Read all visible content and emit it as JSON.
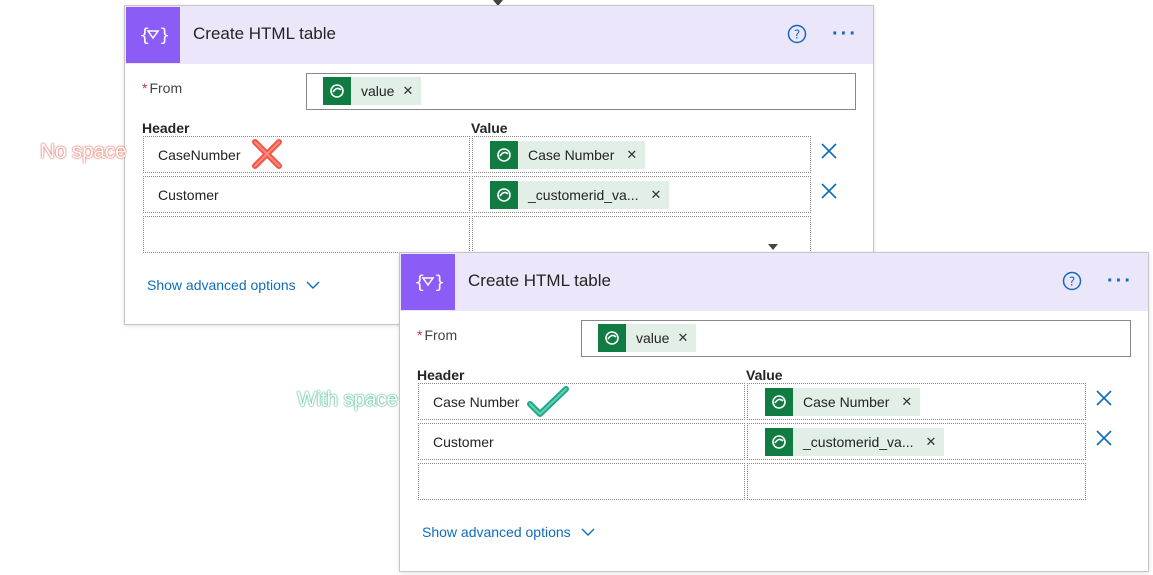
{
  "card1": {
    "title": "Create HTML table",
    "from_label": "From",
    "from_token": "value",
    "col_header": "Header",
    "col_value": "Value",
    "rows": [
      {
        "header": "CaseNumber",
        "value": "Case Number"
      },
      {
        "header": "Customer",
        "value": "_customerid_va..."
      }
    ],
    "advanced": "Show advanced options"
  },
  "card2": {
    "title": "Create HTML table",
    "from_label": "From",
    "from_token": "value",
    "col_header": "Header",
    "col_value": "Value",
    "rows": [
      {
        "header": "Case Number",
        "value": "Case Number"
      },
      {
        "header": "Customer",
        "value": "_customerid_va..."
      }
    ],
    "advanced": "Show advanced options"
  },
  "annotations": {
    "no_space": "No space",
    "with_space": "With space"
  },
  "icons": {
    "action_icon": "variable-braces-icon",
    "token_icon": "dataverse-icon",
    "help": "help-circle-icon",
    "more": "ellipsis-icon",
    "remove": "close-icon",
    "chevron": "chevron-down-icon",
    "wrong": "red-cross-icon",
    "right": "green-check-icon"
  },
  "colors": {
    "accent": "#8b5cf6",
    "header_bg": "#ece6fa",
    "link": "#0f6cbd",
    "token_green": "#107c41",
    "token_bg": "#e1efe6"
  }
}
